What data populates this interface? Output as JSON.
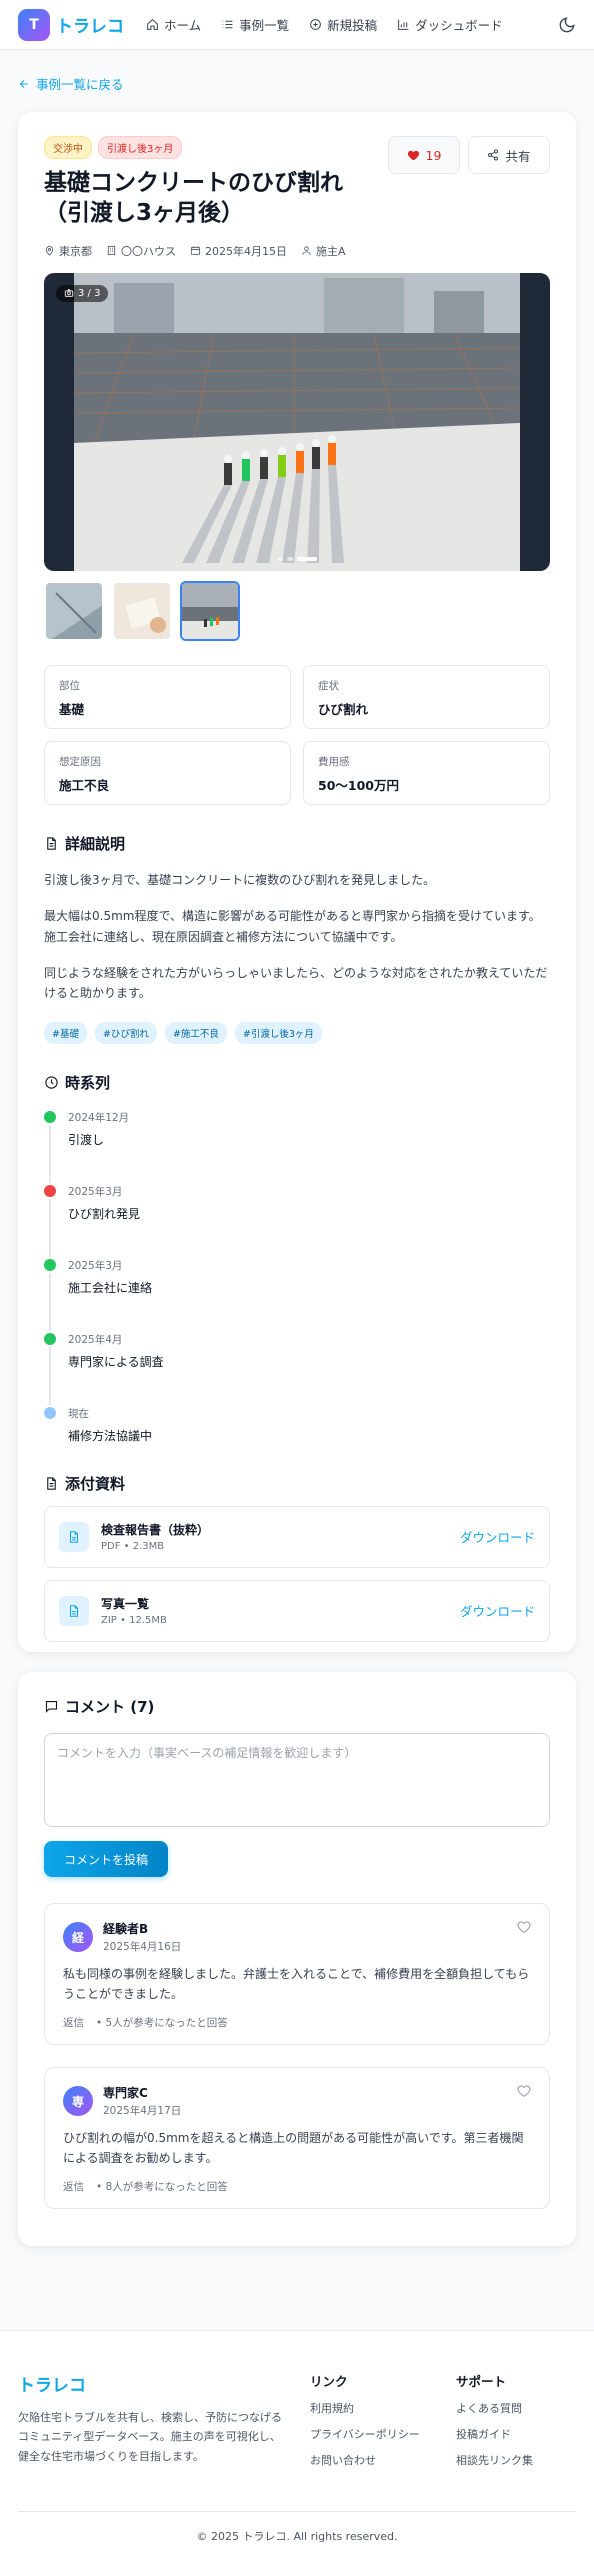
{
  "app": {
    "logo_letter": "T",
    "name": "トラレコ"
  },
  "nav": [
    {
      "label": "ホーム",
      "icon": "home-icon"
    },
    {
      "label": "事例一覧",
      "icon": "list-icon"
    },
    {
      "label": "新規投稿",
      "icon": "plus-circle-icon"
    },
    {
      "label": "ダッシュボード",
      "icon": "bar-chart-icon"
    }
  ],
  "back_link": "事例一覧に戻る",
  "case": {
    "badges": {
      "status": "交渉中",
      "period": "引渡し後3ヶ月"
    },
    "title": "基礎コンクリートのひび割れ（引渡し3ヶ月後）",
    "likes": "19",
    "share_label": "共有",
    "meta": {
      "location": "東京都",
      "company": "〇〇ハウス",
      "date": "2025年4月15日",
      "owner": "施主A"
    },
    "gallery": {
      "counter": "3 / 3",
      "total": 3,
      "active_index": 3
    },
    "attributes": [
      {
        "label": "部位",
        "value": "基礎"
      },
      {
        "label": "症状",
        "value": "ひび割れ"
      },
      {
        "label": "想定原因",
        "value": "施工不良"
      },
      {
        "label": "費用感",
        "value": "50〜100万円"
      }
    ],
    "description_heading": "詳細説明",
    "description": [
      "引渡し後3ヶ月で、基礎コンクリートに複数のひび割れを発見しました。",
      "最大幅は0.5mm程度で、構造に影響がある可能性があると専門家から指摘を受けています。施工会社に連絡し、現在原因調査と補修方法について協議中です。",
      "同じような経験をされた方がいらっしゃいましたら、どのような対応をされたか教えていただけると助かります。"
    ],
    "tags": [
      "#基礎",
      "#ひび割れ",
      "#施工不良",
      "#引渡し後3ヶ月"
    ],
    "timeline_heading": "時系列",
    "timeline": [
      {
        "date": "2024年12月",
        "text": "引渡し",
        "color": "#22c55e"
      },
      {
        "date": "2025年3月",
        "text": "ひび割れ発見",
        "color": "#ef4444"
      },
      {
        "date": "2025年3月",
        "text": "施工会社に連絡",
        "color": "#22c55e"
      },
      {
        "date": "2025年4月",
        "text": "専門家による調査",
        "color": "#22c55e"
      },
      {
        "date": "現在",
        "text": "補修方法協議中",
        "color": "#93c5fd"
      }
    ],
    "attachments_heading": "添付資料",
    "attachments": [
      {
        "name": "検査報告書（抜粋）",
        "meta": "PDF • 2.3MB",
        "action": "ダウンロード"
      },
      {
        "name": "写真一覧",
        "meta": "ZIP • 12.5MB",
        "action": "ダウンロード"
      }
    ]
  },
  "comments": {
    "heading": "コメント (7)",
    "placeholder": "コメントを入力（事実ベースの補足情報を歓迎します）",
    "post_label": "コメントを投稿",
    "items": [
      {
        "avatar": "経",
        "name": "経験者B",
        "date": "2025年4月16日",
        "body": "私も同様の事例を経験しました。弁護士を入れることで、補修費用を全額負担してもらうことができました。",
        "reply": "返信",
        "helpful": "• 5人が参考になったと回答"
      },
      {
        "avatar": "専",
        "name": "専門家C",
        "date": "2025年4月17日",
        "body": "ひび割れの幅が0.5mmを超えると構造上の問題がある可能性が高いです。第三者機関による調査をお勧めします。",
        "reply": "返信",
        "helpful": "• 8人が参考になったと回答"
      }
    ]
  },
  "footer": {
    "brand": "トラレコ",
    "description": "欠陥住宅トラブルを共有し、検索し、予防につなげるコミュニティ型データベース。施主の声を可視化し、健全な住宅市場づくりを目指します。",
    "links_heading": "リンク",
    "links": [
      "利用規約",
      "プライバシーポリシー",
      "お問い合わせ"
    ],
    "support_heading": "サポート",
    "support": [
      "よくある質問",
      "投稿ガイド",
      "相談先リンク集"
    ],
    "copyright": "© 2025 トラレコ. All rights reserved."
  },
  "colors": {
    "accent": "#0ea5e9",
    "danger": "#dc2626",
    "brand_gradient_start": "#3b82f6",
    "brand_gradient_end": "#a855f7"
  }
}
